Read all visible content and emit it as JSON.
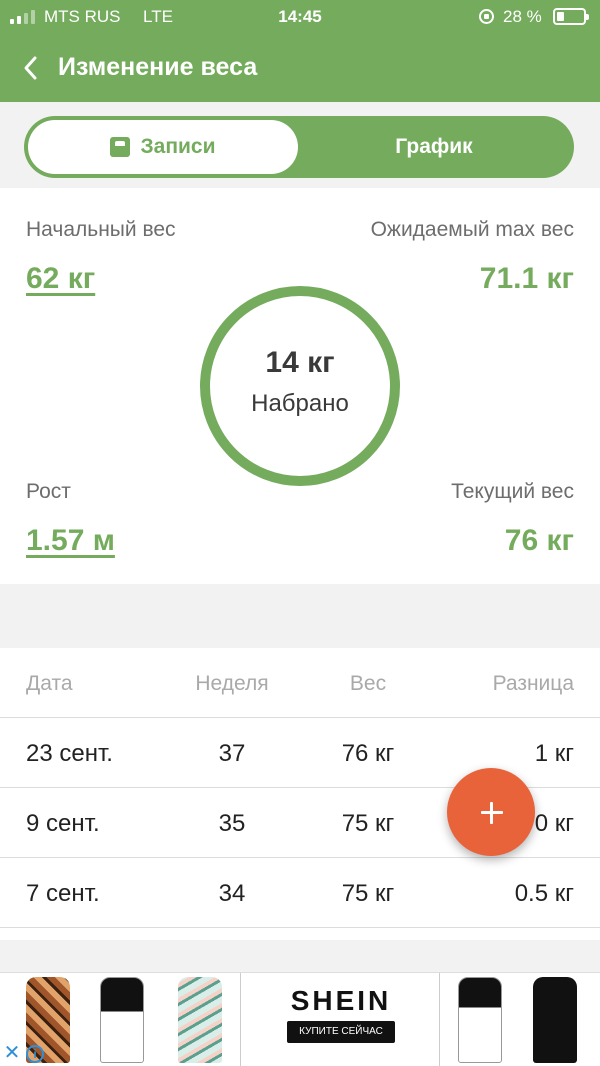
{
  "status_bar": {
    "carrier": "MTS RUS",
    "network": "LTE",
    "time": "14:45",
    "battery": "28 %",
    "battery_level": 0.28,
    "signal_bars": 2
  },
  "header": {
    "title": "Изменение веса",
    "back_icon": "chevron-left-icon"
  },
  "tabs": [
    {
      "label": "Записи",
      "selected": true,
      "icon": "scale-icon"
    },
    {
      "label": "График",
      "selected": false
    }
  ],
  "summary": {
    "start_weight_label": "Начальный вес",
    "start_weight_value": "62 кг",
    "expected_max_label": "Ожидаемый max вес",
    "expected_max_value": "71.1 кг",
    "gained_value": "14 кг",
    "gained_caption": "Набрано",
    "height_label": "Рост",
    "height_value": "1.57 м",
    "current_weight_label": "Текущий вес",
    "current_weight_value": "76 кг"
  },
  "table": {
    "columns": [
      "Дата",
      "Неделя",
      "Вес",
      "Разница"
    ],
    "rows": [
      {
        "date": "23 сент.",
        "week": "37",
        "weight": "76 кг",
        "diff": "1 кг"
      },
      {
        "date": "9 сент.",
        "week": "35",
        "weight": "75 кг",
        "diff": "0 кг"
      },
      {
        "date": "7 сент.",
        "week": "34",
        "weight": "75 кг",
        "diff": "0.5 кг"
      }
    ]
  },
  "fab": {
    "icon": "plus-icon"
  },
  "ad": {
    "brand": "SHEIN",
    "cta": "КУПИТЕ СЕЙЧАС",
    "close_icon": "close-icon",
    "info_icon": "info-icon"
  },
  "colors": {
    "accent": "#75ab5d",
    "fab": "#e8623a",
    "background": "#f2f2f2",
    "muted_text": "#6d6d6d"
  }
}
